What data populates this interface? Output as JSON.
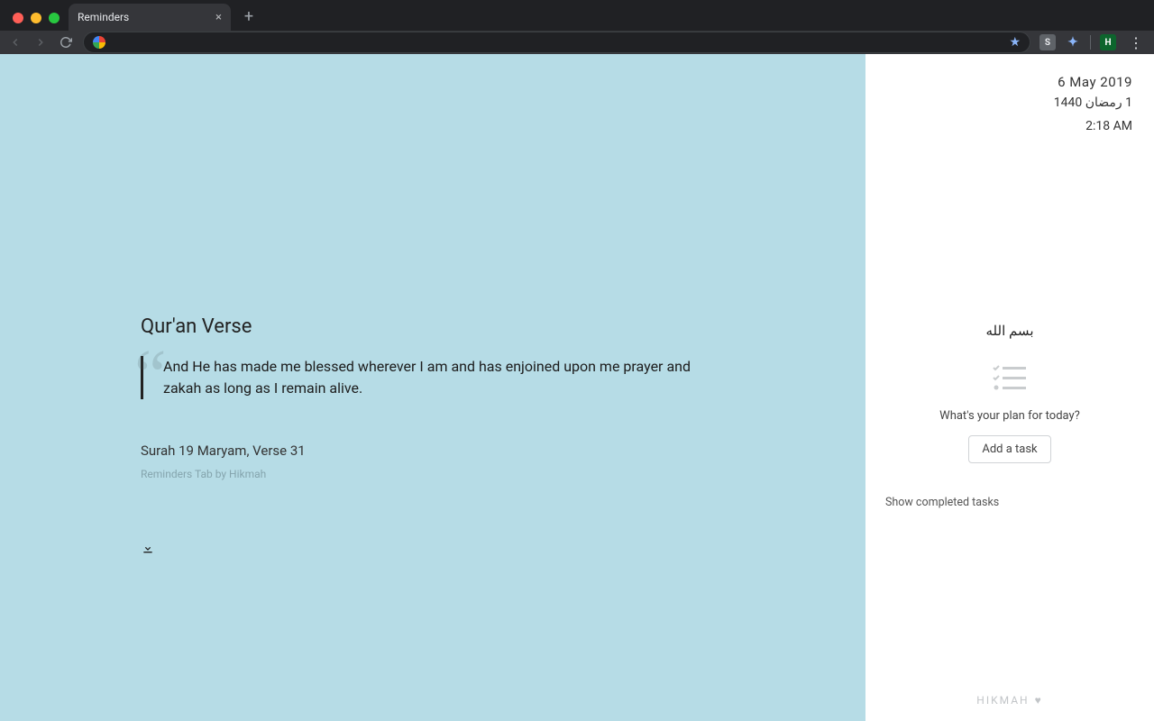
{
  "browser": {
    "tab_title": "Reminders",
    "omnibox_value": ""
  },
  "main": {
    "title": "Qur'an Verse",
    "verse": "And He has made me blessed wherever I am and has enjoined upon me prayer and zakah as long as I remain alive.",
    "reference": "Surah 19 Maryam, Verse 31",
    "credit": "Reminders Tab by Hikmah"
  },
  "sidebar": {
    "date_gregorian": "6 May 2019",
    "date_hijri": "1 رمضان 1440",
    "time": "2:18 AM",
    "bismillah": "بسم الله",
    "task_prompt": "What's your plan for today?",
    "add_task_label": "Add a task",
    "show_completed_label": "Show completed tasks",
    "footer_brand": "HIKMAH"
  }
}
